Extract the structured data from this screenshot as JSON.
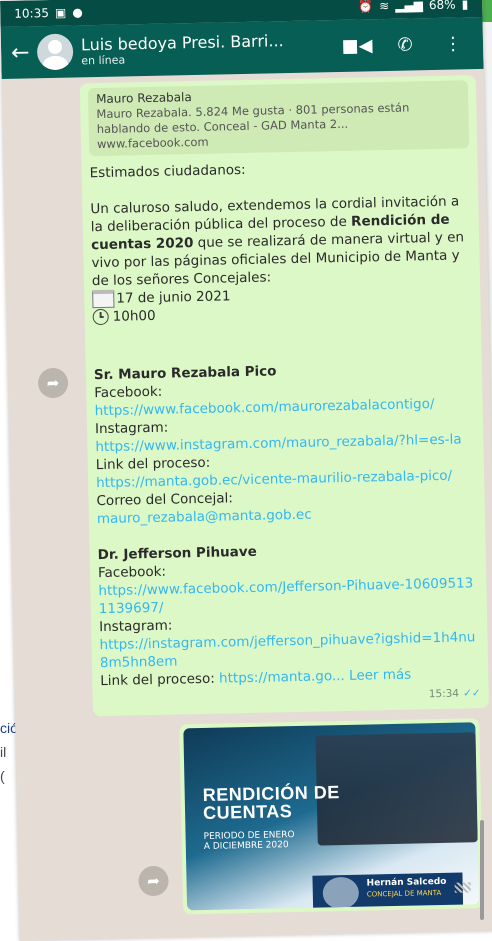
{
  "status_bar": {
    "time": "10:35",
    "battery": "68%"
  },
  "header": {
    "contact_name": "Luis bedoya Presi. Barri...",
    "contact_status": "en línea",
    "back_icon": "arrow-left-icon",
    "video_icon": "video-camera-icon",
    "call_icon": "phone-icon",
    "menu_icon": "more-vert-icon"
  },
  "message": {
    "preview": {
      "title": "Mauro Rezabala",
      "description": "Mauro Rezabala. 5.824 Me gusta · 801 personas están hablando de esto. Conceal - GAD Manta 2...",
      "url": "www.facebook.com"
    },
    "greeting": "Estimados ciudadanos:",
    "body_pre": "Un caluroso saludo, extendemos la cordial invitación a la deliberación pública del proceso de ",
    "body_bold": "Rendición de cuentas 2020",
    "body_post": " que se realizará de manera virtual y en vivo por las páginas oficiales del Municipio de Manta y de los señores Concejales:",
    "date": "17 de junio 2021",
    "time": "10h00",
    "person1": {
      "name": "Sr. Mauro Rezabala Pico",
      "facebook_label": "Facebook:",
      "facebook_url": "https://www.facebook.com/maurorezabalacontigo/",
      "instagram_label": "Instagram:",
      "instagram_url": "https://www.instagram.com/mauro_rezabala/?hl=es-la",
      "process_label": "Link del proceso:",
      "process_url": "https://manta.gob.ec/vicente-maurilio-rezabala-pico/",
      "email_label": "Correo del Concejal:",
      "email": "mauro_rezabala@manta.gob.ec"
    },
    "person2": {
      "name": "Dr. Jefferson Pihuave",
      "facebook_label": "Facebook:",
      "facebook_url": "https://www.facebook.com/Jefferson-Pihuave-106095131139697/",
      "instagram_label": "Instagram:",
      "instagram_url": "https://instagram.com/jefferson_pihuave?igshid=1h4nu8m5hn8em",
      "process_label": "Link del proceso:",
      "process_url": "https://manta.go...",
      "read_more": "Leer más"
    },
    "timestamp": "15:34"
  },
  "image_message": {
    "title_line1": "RENDICIÓN DE",
    "title_line2": "CUENTAS",
    "subtitle_line1": "PERIODO DE ENERO",
    "subtitle_line2": "A DICIEMBRE 2020",
    "badge_name": "Hernán Salcedo",
    "badge_role": "CONCEJAL DE MANTA"
  },
  "background_text": {
    "line1": "ció",
    "line2": "il",
    "line3": "("
  },
  "colors": {
    "header": "#075e54",
    "bubble": "#dcf8c6",
    "link": "#34b7f1",
    "chat_bg": "#e5ddd5"
  }
}
